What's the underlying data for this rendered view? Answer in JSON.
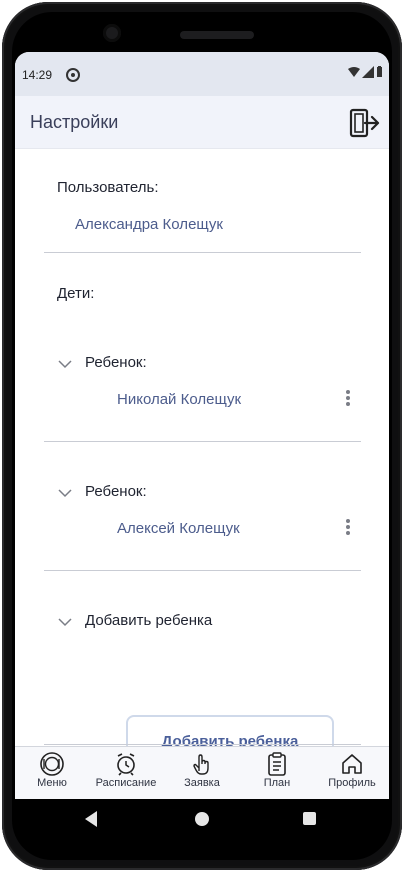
{
  "status": {
    "time": "14:29"
  },
  "header": {
    "title": "Настройки"
  },
  "user": {
    "label": "Пользователь:",
    "name": "Александра Колещук"
  },
  "children": {
    "label": "Дети:",
    "items": [
      {
        "label": "Ребенок:",
        "name": "Николай Колещук"
      },
      {
        "label": "Ребенок:",
        "name": "Алексей Колещук"
      }
    ],
    "add_section_label": "Добавить ребенка",
    "add_button_label": "Добавить ребенка"
  },
  "nav": {
    "items": [
      {
        "label": "Меню",
        "icon": "plate-icon"
      },
      {
        "label": "Расписание",
        "icon": "alarm-clock-icon"
      },
      {
        "label": "Заявка",
        "icon": "hand-pointer-icon"
      },
      {
        "label": "План",
        "icon": "clipboard-icon"
      },
      {
        "label": "Профиль",
        "icon": "home-icon"
      }
    ]
  },
  "colors": {
    "accent": "#4c5c8c",
    "header_bg": "#f1f3fa",
    "statusbar_bg": "#e3e7f0"
  }
}
